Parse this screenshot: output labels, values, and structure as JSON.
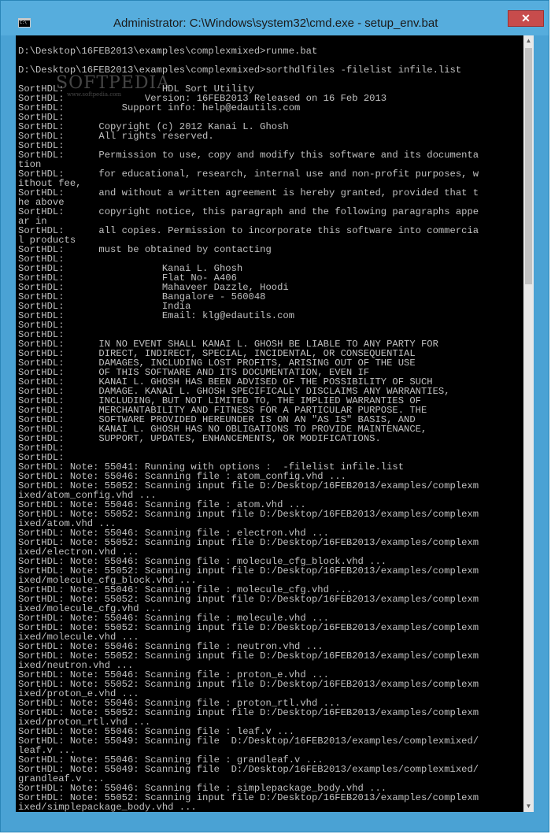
{
  "window": {
    "title": "Administrator: C:\\Windows\\system32\\cmd.exe - setup_env.bat",
    "close_label": "✕",
    "icon": "cmd-icon"
  },
  "watermark": {
    "big": "SOFTPEDIA",
    "small": "www.softpedia.com"
  },
  "console": {
    "lines": [
      "",
      "D:\\Desktop\\16FEB2013\\examples\\complexmixed>runme.bat",
      "",
      "D:\\Desktop\\16FEB2013\\examples\\complexmixed>sorthdlfiles -filelist infile.list",
      "",
      "SortHDL:                 HDL Sort Utility",
      "SortHDL:              Version: 16FEB2013 Released on 16 Feb 2013",
      "SortHDL:          Support info: help@edautils.com",
      "SortHDL:",
      "SortHDL:      Copyright (c) 2012 Kanai L. Ghosh",
      "SortHDL:      All rights reserved.",
      "SortHDL:",
      "SortHDL:      Permission to use, copy and modify this software and its documenta",
      "tion",
      "SortHDL:      for educational, research, internal use and non-profit purposes, w",
      "ithout fee,",
      "SortHDL:      and without a written agreement is hereby granted, provided that t",
      "he above",
      "SortHDL:      copyright notice, this paragraph and the following paragraphs appe",
      "ar in",
      "SortHDL:      all copies. Permission to incorporate this software into commercia",
      "l products",
      "SortHDL:      must be obtained by contacting",
      "SortHDL:",
      "SortHDL:                 Kanai L. Ghosh",
      "SortHDL:                 Flat No- A406",
      "SortHDL:                 Mahaveer Dazzle, Hoodi",
      "SortHDL:                 Bangalore - 560048",
      "SortHDL:                 India",
      "SortHDL:                 Email: klg@edautils.com",
      "SortHDL:",
      "SortHDL:",
      "SortHDL:      IN NO EVENT SHALL KANAI L. GHOSH BE LIABLE TO ANY PARTY FOR",
      "SortHDL:      DIRECT, INDIRECT, SPECIAL, INCIDENTAL, OR CONSEQUENTIAL",
      "SortHDL:      DAMAGES, INCLUDING LOST PROFITS, ARISING OUT OF THE USE",
      "SortHDL:      OF THIS SOFTWARE AND ITS DOCUMENTATION, EVEN IF",
      "SortHDL:      KANAI L. GHOSH HAS BEEN ADVISED OF THE POSSIBILITY OF SUCH",
      "SortHDL:      DAMAGE. KANAI L. GHOSH SPECIFICALLY DISCLAIMS ANY WARRANTIES,",
      "SortHDL:      INCLUDING, BUT NOT LIMITED TO, THE IMPLIED WARRANTIES OF",
      "SortHDL:      MERCHANTABILITY AND FITNESS FOR A PARTICULAR PURPOSE. THE",
      "SortHDL:      SOFTWARE PROVIDED HEREUNDER IS ON AN \"AS IS\" BASIS, AND",
      "SortHDL:      KANAI L. GHOSH HAS NO OBLIGATIONS TO PROVIDE MAINTENANCE,",
      "SortHDL:      SUPPORT, UPDATES, ENHANCEMENTS, OR MODIFICATIONS.",
      "SortHDL:",
      "SortHDL:",
      "SortHDL: Note: 55041: Running with options :  -filelist infile.list",
      "SortHDL: Note: 55046: Scanning file : atom_config.vhd ...",
      "SortHDL: Note: 55052: Scanning input file D:/Desktop/16FEB2013/examples/complexm",
      "ixed/atom_config.vhd ...",
      "SortHDL: Note: 55046: Scanning file : atom.vhd ...",
      "SortHDL: Note: 55052: Scanning input file D:/Desktop/16FEB2013/examples/complexm",
      "ixed/atom.vhd ...",
      "SortHDL: Note: 55046: Scanning file : electron.vhd ...",
      "SortHDL: Note: 55052: Scanning input file D:/Desktop/16FEB2013/examples/complexm",
      "ixed/electron.vhd ...",
      "SortHDL: Note: 55046: Scanning file : molecule_cfg_block.vhd ...",
      "SortHDL: Note: 55052: Scanning input file D:/Desktop/16FEB2013/examples/complexm",
      "ixed/molecule_cfg_block.vhd ...",
      "SortHDL: Note: 55046: Scanning file : molecule_cfg.vhd ...",
      "SortHDL: Note: 55052: Scanning input file D:/Desktop/16FEB2013/examples/complexm",
      "ixed/molecule_cfg.vhd ...",
      "SortHDL: Note: 55046: Scanning file : molecule.vhd ...",
      "SortHDL: Note: 55052: Scanning input file D:/Desktop/16FEB2013/examples/complexm",
      "ixed/molecule.vhd ...",
      "SortHDL: Note: 55046: Scanning file : neutron.vhd ...",
      "SortHDL: Note: 55052: Scanning input file D:/Desktop/16FEB2013/examples/complexm",
      "ixed/neutron.vhd ...",
      "SortHDL: Note: 55046: Scanning file : proton_e.vhd ...",
      "SortHDL: Note: 55052: Scanning input file D:/Desktop/16FEB2013/examples/complexm",
      "ixed/proton_e.vhd ...",
      "SortHDL: Note: 55046: Scanning file : proton_rtl.vhd ...",
      "SortHDL: Note: 55052: Scanning input file D:/Desktop/16FEB2013/examples/complexm",
      "ixed/proton_rtl.vhd ...",
      "SortHDL: Note: 55046: Scanning file : leaf.v ...",
      "SortHDL: Note: 55049: Scanning file  D:/Desktop/16FEB2013/examples/complexmixed/",
      "leaf.v ...",
      "SortHDL: Note: 55046: Scanning file : grandleaf.v ...",
      "SortHDL: Note: 55049: Scanning file  D:/Desktop/16FEB2013/examples/complexmixed/",
      "grandleaf.v ...",
      "SortHDL: Note: 55046: Scanning file : simplepackage_body.vhd ...",
      "SortHDL: Note: 55052: Scanning input file D:/Desktop/16FEB2013/examples/complexm",
      "ixed/simplepackage_body.vhd ..."
    ]
  }
}
